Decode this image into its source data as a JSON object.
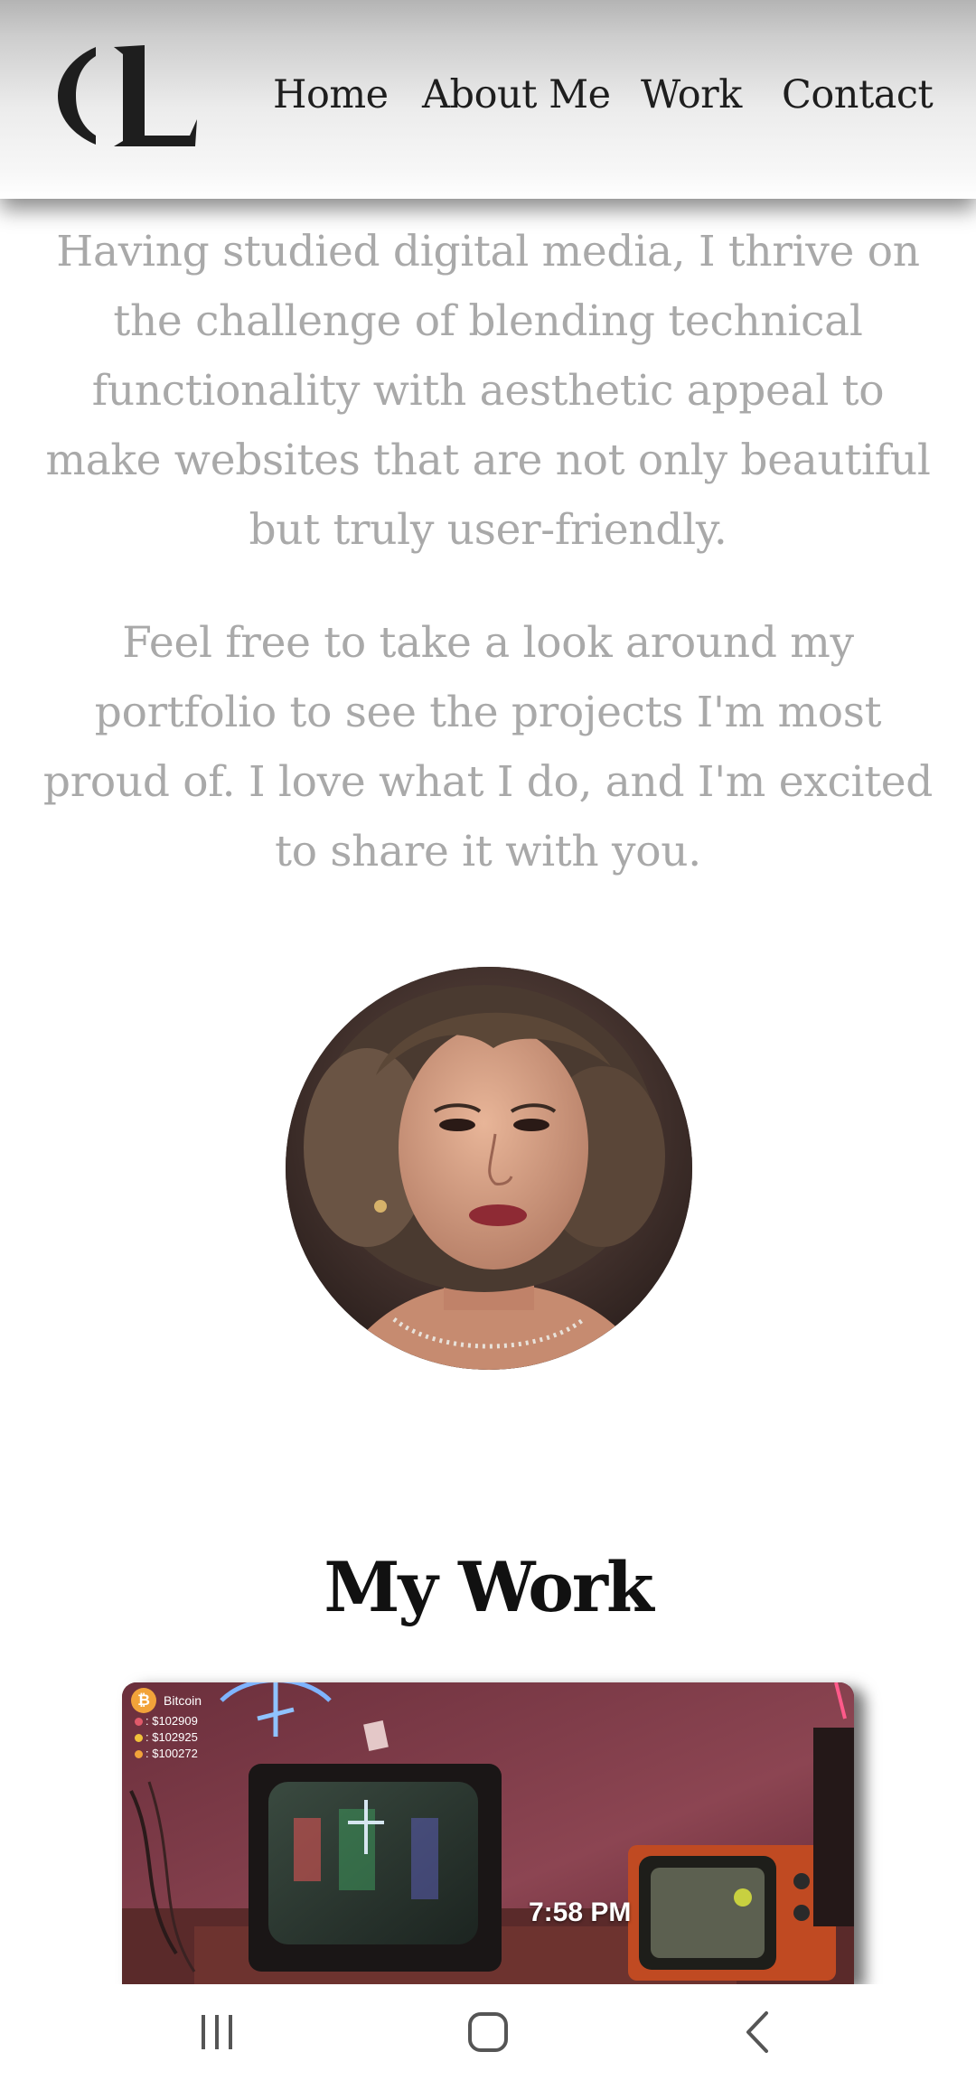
{
  "header": {
    "logo_alt": "CL",
    "nav": [
      {
        "label": "Home"
      },
      {
        "label": "About Me"
      },
      {
        "label": "Work"
      },
      {
        "label": "Contact"
      }
    ]
  },
  "intro": {
    "paragraph1": "Having studied digital media, I thrive on the challenge of blending technical functionality with aesthetic appeal to make websites that are not only beautiful but truly user-friendly.",
    "paragraph2": "Feel free to take a look around my portfolio to see the projects I'm most proud of. I love what I do, and I'm excited to share it with you."
  },
  "work": {
    "title": "My Work",
    "project": {
      "widget_title": "Bitcoin",
      "prices": [
        ": $102909",
        ": $102925",
        ": $100272"
      ],
      "clock": "7:58 PM"
    }
  },
  "colors": {
    "nav_text": "#1e1e1e",
    "paragraph_text": "#a9a9a9",
    "title_text": "#111111",
    "bitcoin_orange": "#f2a33a"
  },
  "system_nav": {
    "recents_icon": "recents-icon",
    "home_icon": "home-icon",
    "back_icon": "back-icon"
  }
}
